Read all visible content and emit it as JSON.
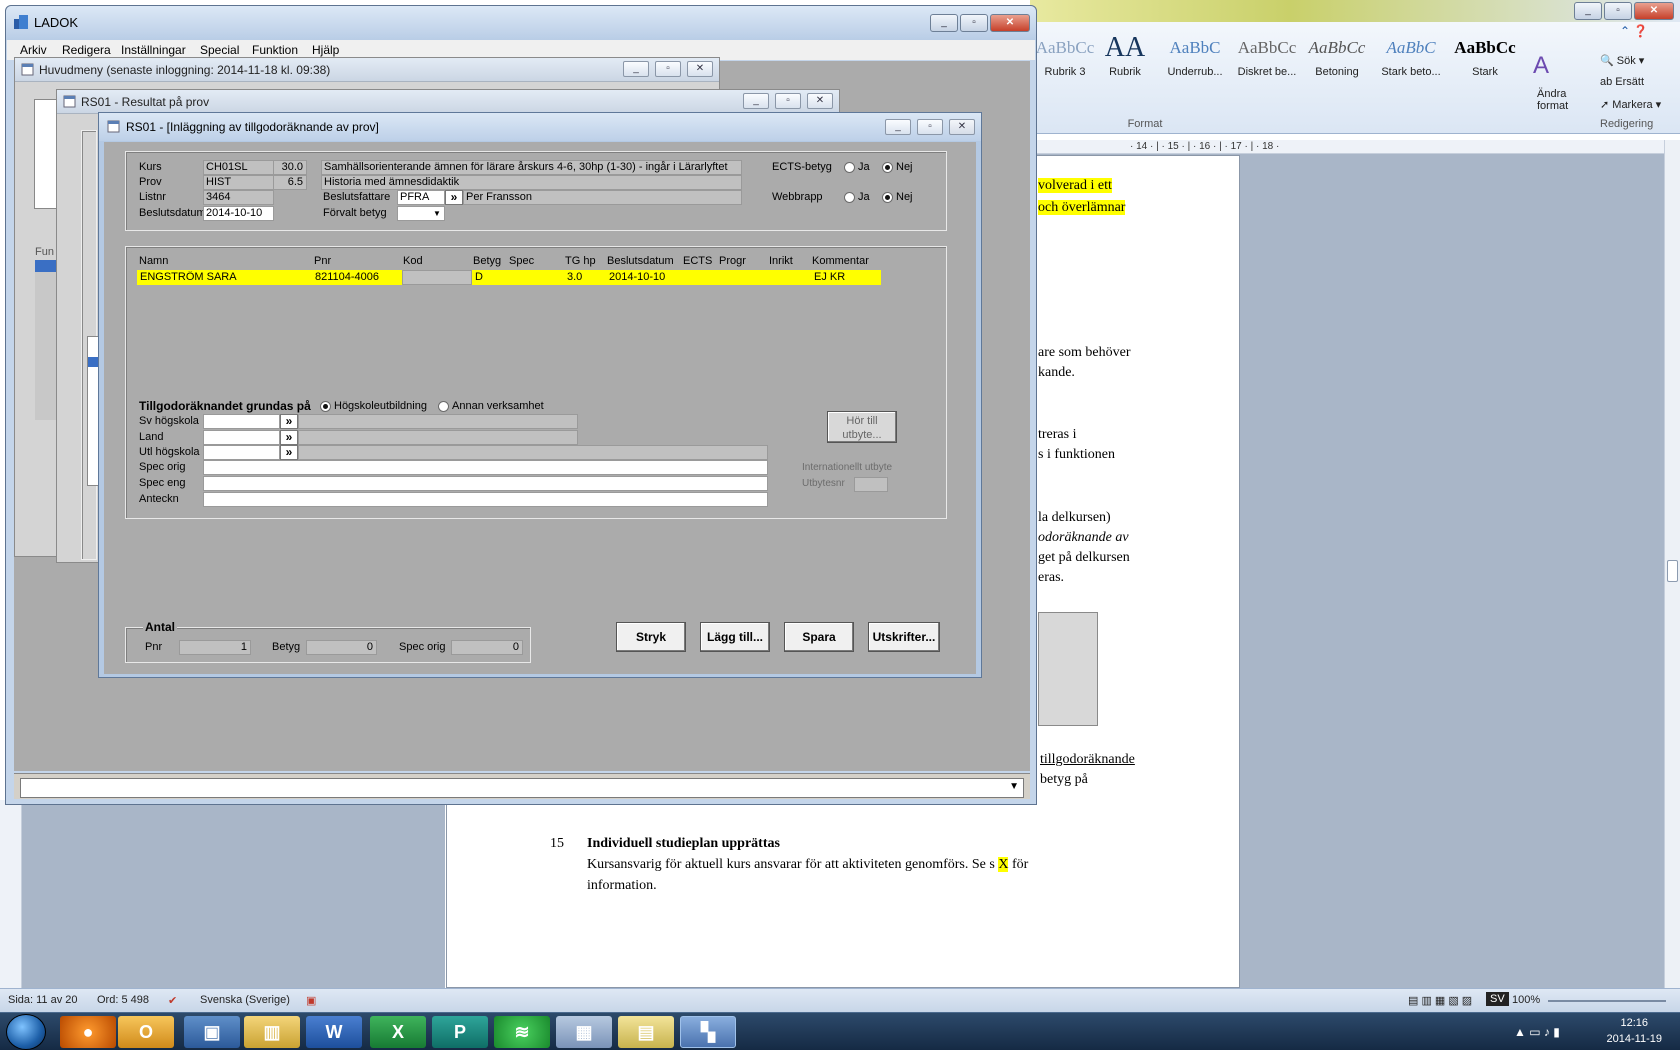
{
  "word": {
    "styles": [
      {
        "preview": "AaBbCc",
        "name": "Rubrik 3"
      },
      {
        "preview": "AA",
        "name": "Rubrik"
      },
      {
        "preview": "AaBbC",
        "name": "Underrub..."
      },
      {
        "preview": "AaBbCc",
        "name": "Diskret be..."
      },
      {
        "preview": "AaBbCc",
        "name": "Betoning"
      },
      {
        "preview": "AaBbC",
        "name": "Stark beto..."
      },
      {
        "preview": "AaBbCc",
        "name": "Stark"
      }
    ],
    "change_styles": "Ändra format",
    "group_format": "Format",
    "group_edit": "Redigering",
    "edit_find": "Sök",
    "edit_replace": "Ersätt",
    "edit_select": "Markera",
    "ruler": "· 14 · | · 15 · | · 16 · | · 17 · | · 18 ·",
    "doc_lines": [
      {
        "text": "volverad i ett",
        "hl": true
      },
      {
        "text": "och överlämnar",
        "hl": true
      },
      {
        "text": "are som behöver",
        "hl": false
      },
      {
        "text": "kande.",
        "hl": false
      },
      {
        "text": "treras i",
        "hl": false
      },
      {
        "text": "s i funktionen",
        "hl": false
      },
      {
        "text": "la delkursen)",
        "hl": false
      },
      {
        "text": "odoräknande av",
        "hl": false
      },
      {
        "text": "get på delkursen",
        "hl": false
      },
      {
        "text": "eras.",
        "hl": false
      },
      {
        "text": "tillgodoräknande",
        "hl": false
      },
      {
        "text": "betyg på",
        "hl": false
      }
    ],
    "section_number": "15",
    "section_title": "Individuell studieplan upprättas",
    "section_text_a": "Kursansvarig för aktuell kurs ansvarar för att aktiviteten genomförs. Se s",
    "section_text_x": "X",
    "section_text_b": "för",
    "section_text_c": "information.",
    "status_page": "Sida: 11 av 20",
    "status_words": "Ord: 5 498",
    "status_lang": "Svenska (Sverige)",
    "status_zoom": "100%",
    "status_sv": "SV"
  },
  "taskbar": {
    "time": "12:16",
    "date": "2014-11-19"
  },
  "ladok": {
    "title": "LADOK",
    "menu": [
      "Arkiv",
      "Redigera",
      "Inställningar",
      "Special",
      "Funktion",
      "Hjälp"
    ],
    "huvudmeny_title": "Huvudmeny   (senaste inloggning:  2014-11-18 kl. 09:38)",
    "resultat_title": "RS01 - Resultat på prov",
    "huvudmeny_side": "Fun"
  },
  "dialog": {
    "title": "RS01 - [Inläggning av tillgodoräknande av prov]",
    "kurs_label": "Kurs",
    "kurs_code": "CH01SL",
    "kurs_hp": "30.0",
    "kurs_name": "Samhällsorienterande ämnen för lärare årskurs 4-6, 30hp (1-30) - ingår i Lärarlyftet",
    "prov_label": "Prov",
    "prov_code": "HIST",
    "prov_hp": "6.5",
    "prov_name": "Historia med ämnesdidaktik",
    "listnr_label": "Listnr",
    "listnr": "3464",
    "beslutsfattare_label": "Beslutsfattare",
    "beslutsfattare_code": "PFRA",
    "beslutsfattare_name": "Per Fransson",
    "beslutsdatum_label": "Beslutsdatum",
    "beslutsdatum": "2014-10-10",
    "forvalt_betyg_label": "Förvalt betyg",
    "forvalt_betyg": "",
    "ects_label": "ECTS-betyg",
    "webbrapp_label": "Webbrapp",
    "ja": "Ja",
    "nej": "Nej",
    "columns": [
      "Namn",
      "Pnr",
      "Kod",
      "Betyg",
      "Spec",
      "TG hp",
      "Beslutsdatum",
      "ECTS",
      "Progr",
      "Inrikt",
      "Kommentar"
    ],
    "rows": [
      {
        "namn": "ENGSTRÖM SARA",
        "pnr": "821104-4006",
        "kod": "",
        "betyg": "D",
        "spec": "",
        "tghp": "3.0",
        "beslutsdatum": "2014-10-10",
        "ects": "",
        "progr": "",
        "inrikt": "",
        "kommentar": "EJ KR"
      }
    ],
    "grundas_label": "Tillgodoräknandet grundas på",
    "hogskole_opt": "Högskoleutbildning",
    "annan_opt": "Annan verksamhet",
    "sv_hogskola": "Sv högskola",
    "land": "Land",
    "utl_hogskola": "Utl högskola",
    "spec_orig": "Spec orig",
    "spec_eng": "Spec eng",
    "anteckn": "Anteckn",
    "hor_till_utbyte": "Hör till utbyte...",
    "internationellt_utbyte": "Internationellt utbyte",
    "utbytesnr": "Utbytesnr",
    "antal_label": "Antal",
    "antal_pnr_label": "Pnr",
    "antal_pnr": "1",
    "antal_betyg_label": "Betyg",
    "antal_betyg": "0",
    "antal_spec_label": "Spec orig",
    "antal_spec": "0",
    "btn_stryk": "Stryk",
    "btn_lagg_till": "Lägg till...",
    "btn_spara": "Spara",
    "btn_utskrifter": "Utskrifter..."
  },
  "colors": {
    "highlight": "#ffff00",
    "client": "#ababab",
    "title_blue": "#bdd0e8"
  }
}
